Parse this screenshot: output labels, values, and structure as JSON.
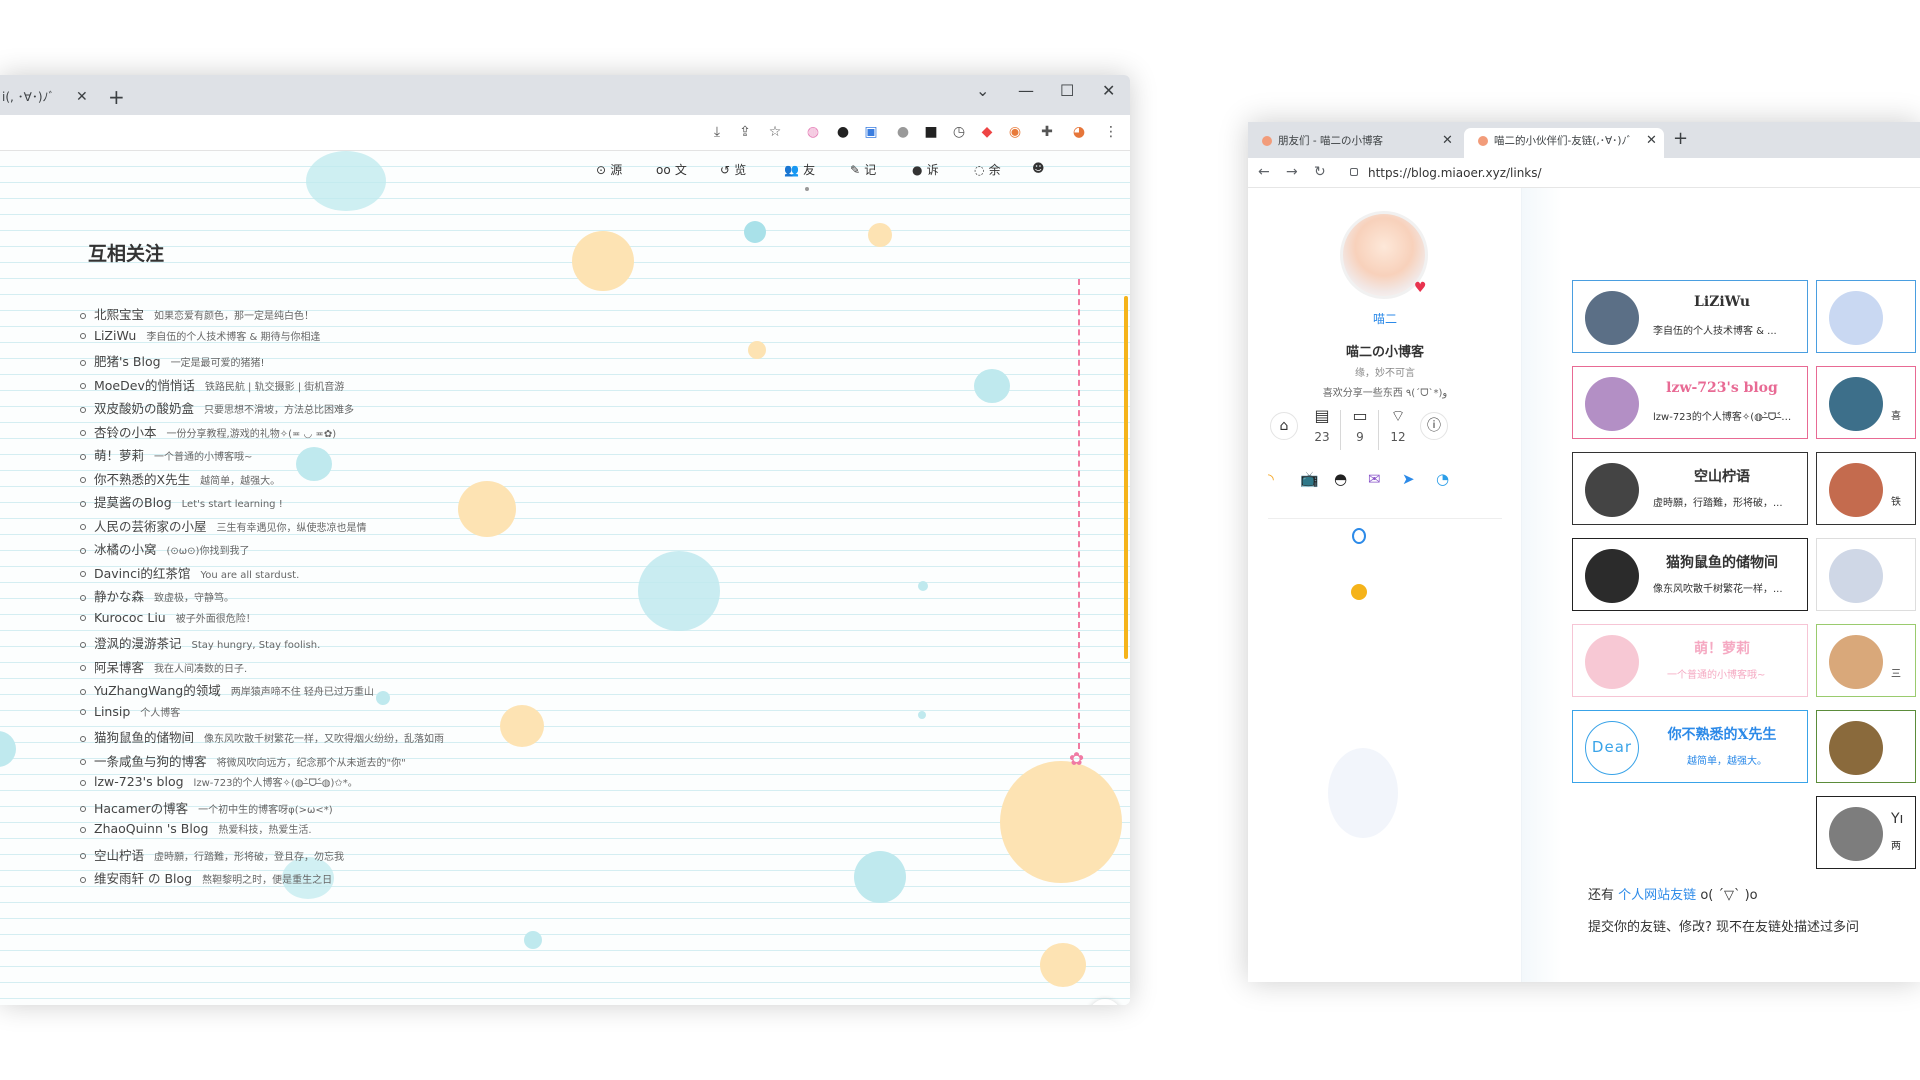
{
  "left_window": {
    "tab_title": "i(, ･∀･)ﾉﾞ",
    "nav": [
      {
        "icon": "⊙",
        "label": "源"
      },
      {
        "icon": "oo",
        "label": "文"
      },
      {
        "icon": "↺",
        "label": "览"
      },
      {
        "icon": "👥",
        "label": "友"
      },
      {
        "icon": "✎",
        "label": "记"
      },
      {
        "icon": "●",
        "label": "诉"
      },
      {
        "icon": "◌",
        "label": "余"
      }
    ],
    "heading": "互相关注",
    "friends": [
      {
        "name": "北熙宝宝",
        "desc": "如果恋爱有颜色，那一定是纯白色！"
      },
      {
        "name": "LiZiWu",
        "desc": "李自伍的个人技术博客 & 期待与你相逢"
      },
      {
        "name": "肥猪's Blog",
        "desc": "一定是最可爱的猪猪!"
      },
      {
        "name": "MoeDev的悄悄话",
        "desc": "铁路民航 | 轨交摄影 | 街机音游"
      },
      {
        "name": "双皮酸奶の酸奶盒",
        "desc": "只要思想不滑坡，方法总比困难多"
      },
      {
        "name": "杏铃の小本",
        "desc": "一份分享教程,游戏的礼物✧(≖ ◡ ≖✿)"
      },
      {
        "name": "萌！萝莉",
        "desc": "一个普通的小博客哦~"
      },
      {
        "name": "你不熟悉的X先生",
        "desc": "越简单，越强大。"
      },
      {
        "name": "提莫酱のBlog",
        "desc": "Let's start learning !"
      },
      {
        "name": "人民の芸術家の小屋",
        "desc": "三生有幸遇见你，纵使悲凉也是情"
      },
      {
        "name": "冰橘の小窝",
        "desc": "(⊙ω⊙)你找到我了"
      },
      {
        "name": "Davinci的红茶馆",
        "desc": "You are all stardust."
      },
      {
        "name": "静かな森",
        "desc": "致虚极，守静笃。"
      },
      {
        "name": "Kurococ Liu",
        "desc": "被子外面很危险！"
      },
      {
        "name": "澄沨的漫游茶记",
        "desc": "Stay hungry, Stay foolish."
      },
      {
        "name": "阿呆博客",
        "desc": "我在人间凑数的日子."
      },
      {
        "name": "YuZhangWang的领域",
        "desc": "两岸猿声啼不住 轻舟已过万重山"
      },
      {
        "name": "Linsip",
        "desc": "个人博客"
      },
      {
        "name": "猫狗鼠鱼的储物间",
        "desc": "像东风吹散千树繁花一样，又吹得烟火纷纷，乱落如雨"
      },
      {
        "name": "一条咸鱼与狗的博客",
        "desc": "将微风吹向远方，纪念那个从未逝去的\"你\""
      },
      {
        "name": "lzw-723's blog",
        "desc": "lzw-723的个人博客✧(◍˃̶ᗜ˂̶◍)✩*。"
      },
      {
        "name": "Hacamerの博客",
        "desc": "一个初中生的博客呀φ(>ω<*)"
      },
      {
        "name": "ZhaoQuinn 's Blog",
        "desc": "热爱科技，热爱生活."
      },
      {
        "name": "空山柠语",
        "desc": "虚時願，行踏難，形将破，登且存，勿忘我"
      },
      {
        "name": "维安雨轩 の Blog",
        "desc": "熬靼黎明之时，便是重生之日"
      }
    ],
    "colors": {
      "accent": "#f5b31a",
      "dash": "#f17aa1",
      "flower_blue": "#bfe9ee",
      "flower_yellow": "#fde3b3"
    }
  },
  "right_window": {
    "tabs": [
      {
        "title": "朋友们 - 喵二の小博客",
        "active": false
      },
      {
        "title": "喵二的小伙伴们-友链(,･∀･)ﾉﾞ",
        "active": true
      }
    ],
    "url": "https://blog.miaoer.xyz/links/",
    "profile": {
      "handle": "喵二",
      "site_name": "喵二の小博客",
      "motto": "缘，妙不可言",
      "bio": "喜欢分享一些东西 ٩(ˊᗜˋ*)و"
    },
    "stats": [
      {
        "icon": "archive-icon",
        "value": "23"
      },
      {
        "icon": "folder-icon",
        "value": "9"
      },
      {
        "icon": "tag-icon",
        "value": "12"
      }
    ],
    "cards": [
      {
        "name": "LiZiWu",
        "desc": "李自伍的个人技术博客 & ...",
        "border": "#4a9ee0",
        "name_color": "#333",
        "avatar": "#5b6f86"
      },
      {
        "name": "lzw-723's blog",
        "desc": "lzw-723的个人博客✧(◍˃̶ᗜ˂̶◍)✩...",
        "border": "#e86a94",
        "name_color": "#e86a94",
        "avatar": "#b38fc5"
      },
      {
        "name": "空山柠语",
        "desc": "虚時願，行踏難，形将破，...",
        "border": "#333333",
        "name_color": "#333",
        "avatar": "#444444"
      },
      {
        "name": "猫狗鼠鱼的储物间",
        "desc": "像东风吹散千树繁花一样，...",
        "border": "#222222",
        "name_color": "#333",
        "avatar": "#2b2b2b"
      },
      {
        "name": "萌！萝莉",
        "desc": "一个普通的小博客哦~",
        "border": "#f6c5d5",
        "name_color": "#f5a9c2",
        "avatar": "#f7c8d4"
      },
      {
        "name": "你不熟悉的X先生",
        "desc": "越简单，越强大。",
        "border": "#39a3e8",
        "name_color": "#2c8ae8",
        "avatar": "#ffffff"
      }
    ],
    "dear_logo": "Dear",
    "partial_cards": [
      {
        "border": "#4a9ee0",
        "avatar": "#c9d8f2",
        "snippet": ""
      },
      {
        "border": "#e86a94",
        "avatar": "#3d6f8a",
        "snippet": "喜"
      },
      {
        "border": "#333333",
        "avatar": "#c46b4e",
        "snippet": "铁"
      },
      {
        "border": "#dddddd",
        "avatar": "#cfd7e6",
        "snippet": ""
      },
      {
        "border": "#9acb6e",
        "avatar": "#d9a87a",
        "snippet": "三"
      },
      {
        "border": "#5b8c3a",
        "avatar": "#8a6a3c",
        "snippet": ""
      },
      {
        "border": "#222222",
        "avatar": "#7d7d7d",
        "snippet": "Yı"
      },
      {
        "border": "#222222",
        "avatar": "#7d7d7d",
        "snippet": "两"
      }
    ],
    "footer": {
      "line1_prefix": "还有",
      "line1_link": "个人网站友链",
      "line1_suffix": "o( ´▽` )o",
      "line2": "提交你的友链、修改? 现不在友链处描述过多问"
    }
  }
}
